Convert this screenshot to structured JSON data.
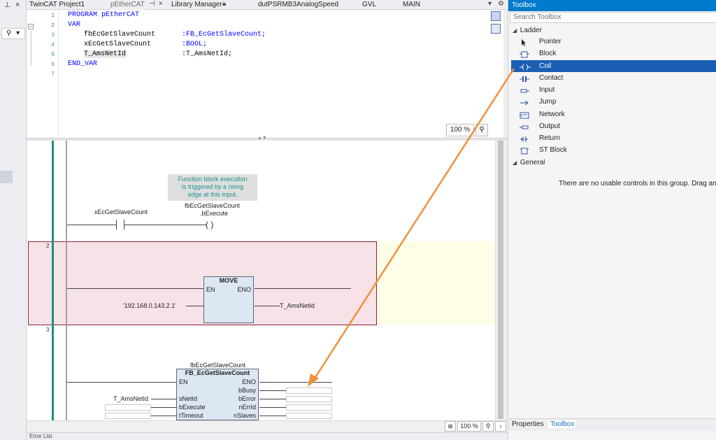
{
  "left_strip": {
    "pin": "⊥",
    "close": "×",
    "search_icon": "⚲",
    "search_caret": "▾"
  },
  "tabs": {
    "project": "TwinCAT Project1",
    "pethercat": "pEtherCAT",
    "pethercat_pin": "⊣",
    "pethercat_close": "×",
    "library_manager": "Library Manager",
    "dut": "dutPSRMB3AnalogSpeed",
    "gvl": "GVL",
    "main": "MAIN",
    "dropdown": "▾",
    "settings": "⚙"
  },
  "declaration": {
    "lines": [
      "1",
      "2",
      "3",
      "4",
      "5",
      "6",
      "7"
    ],
    "program": "PROGRAM pEtherCAT",
    "var": "VAR",
    "v1_name": "fbEcGetSlaveCount",
    "v1_type": ":FB_EcGetSlaveCount;",
    "v2_name": "xEcGetSlaveCount",
    "v2_type": ":BOOL;",
    "v3_name": "T_AmsNetId",
    "v3_type": ":T_AmsNetId;",
    "end_var": "END_VAR",
    "zoom": "100 %"
  },
  "ladder": {
    "rung1": {
      "comment_l1": "Function block execution",
      "comment_l2": "is triggered by a rising",
      "comment_l3": "edge at this input.",
      "contact_var": "xEcGetSlaveCount",
      "coil_var_l1": "fbEcGetSlaveCount",
      "coil_var_l2": ".bExecute"
    },
    "rung2": {
      "num": "2",
      "fb_title": "MOVE",
      "en": "EN",
      "eno": "ENO",
      "input_value": "'192.168.0.143.2.1'",
      "output_var": "T_AmsNetId"
    },
    "rung3": {
      "num": "3",
      "instance": "fbEcGetSlaveCount",
      "fb_title": "FB_EcGetSlaveCount",
      "en": "EN",
      "eno": "ENO",
      "in_snetid": "sNetId",
      "in_bexecute": "bExecute",
      "in_ttimeout": "tTimeout",
      "out_bbusy": "bBusy",
      "out_berror": "bError",
      "out_nerrid": "nErrId",
      "out_nslaves": "nSlaves",
      "snetid_value": "T_AmsNetId"
    },
    "zoom": "100 %"
  },
  "statusbar": {
    "text": "Error List"
  },
  "toolbox": {
    "title": "Toolbox",
    "search_placeholder": "Search Toolbox",
    "group_ladder": "Ladder",
    "items": [
      {
        "label": "Pointer"
      },
      {
        "label": "Block"
      },
      {
        "label": "Coil"
      },
      {
        "label": "Contact"
      },
      {
        "label": "Input"
      },
      {
        "label": "Jump"
      },
      {
        "label": "Network"
      },
      {
        "label": "Output"
      },
      {
        "label": "Return"
      },
      {
        "label": "ST Block"
      }
    ],
    "group_general": "General",
    "empty_message": "There are no usable controls in this group. Drag an it",
    "tab_properties": "Properties",
    "tab_toolbox": "Toolbox"
  },
  "colors": {
    "accent": "#007acc",
    "selection": "#1a5fb4",
    "rail": "#1a8f86",
    "arrow": "#f0913a"
  }
}
